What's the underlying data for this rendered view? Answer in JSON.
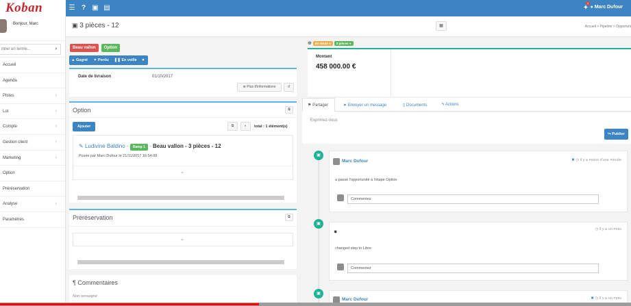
{
  "logo_text": "Koban",
  "topbar": {
    "user": "Marc Dufour",
    "notif_count": "1"
  },
  "sidebar": {
    "greeting": "Bonjour, Marc",
    "search_placeholder": "ntrer un terme...",
    "items": [
      {
        "label": "Accueil",
        "caret": false
      },
      {
        "label": "Agenda",
        "caret": false
      },
      {
        "label": "Pistes",
        "caret": true
      },
      {
        "label": "Lot",
        "caret": true
      },
      {
        "label": "Compte",
        "caret": true
      },
      {
        "label": "Gestion client",
        "caret": true
      },
      {
        "label": "Marketing",
        "caret": true
      },
      {
        "label": "Option",
        "caret": false
      },
      {
        "label": "Préréservation",
        "caret": false
      },
      {
        "label": "Analyse",
        "caret": true
      },
      {
        "label": "Paramètres",
        "caret": false
      }
    ]
  },
  "header": {
    "title": "3 pièces - 12",
    "breadcrumb": "Accueil  >  Pipeline  >  Opportuni"
  },
  "labels": {
    "beau_vallon": "Beau vallon",
    "option": "Option"
  },
  "actions": {
    "gagne": "Gagné",
    "perdu": "Perdu",
    "en_veille": "En veille"
  },
  "details": {
    "livraison_label": "Date de livraison",
    "livraison_value": "01/10/2017",
    "more_info": "Plus d'informations"
  },
  "option_panel": {
    "title": "Option",
    "add": "Ajouter",
    "total": "total : 1 élément(s)",
    "person": "Ludivine Baldino",
    "badge": "Ramp 1",
    "item": "Beau vallon - 3 pièces - 12",
    "posted": "Posée par Marc Dufour le 21/11/2017 16:54:08"
  },
  "prereservation_panel": {
    "title": "Préréservation"
  },
  "comments_panel": {
    "title": "Commentaires",
    "subtitle": "Non renseigné"
  },
  "stage_badges": {
    "en_vente": "En Vente ●",
    "option": "3 pièces ●"
  },
  "montant": {
    "label": "Montant",
    "value": "458 000.00 €"
  },
  "tabs": [
    "Partager",
    "Envoyer un message",
    "Documents",
    "Actions"
  ],
  "share": {
    "placeholder": "Exprimez-vous",
    "publish": "Publier"
  },
  "timeline": [
    {
      "author": "Marc Dufour",
      "time": "il y a moins d'une minute",
      "text": "a passé l'opportunité à l'étape Option",
      "comment_placeholder": "Commentez"
    },
    {
      "author": "",
      "time": "il y a un mois",
      "text": "changed step to Libre",
      "comment_placeholder": "Commentez"
    },
    {
      "author": "Marc Dufour",
      "time": "il y a un mois",
      "text": "",
      "comment_placeholder": ""
    }
  ],
  "video_progress": 0.41,
  "colors": {
    "brand_blue": "#3c84c2",
    "danger": "#d9534f",
    "success": "#5cb85c",
    "teal": "#1fb394",
    "accent_line": "#5bb7e6",
    "logo_red": "#c12a30"
  }
}
